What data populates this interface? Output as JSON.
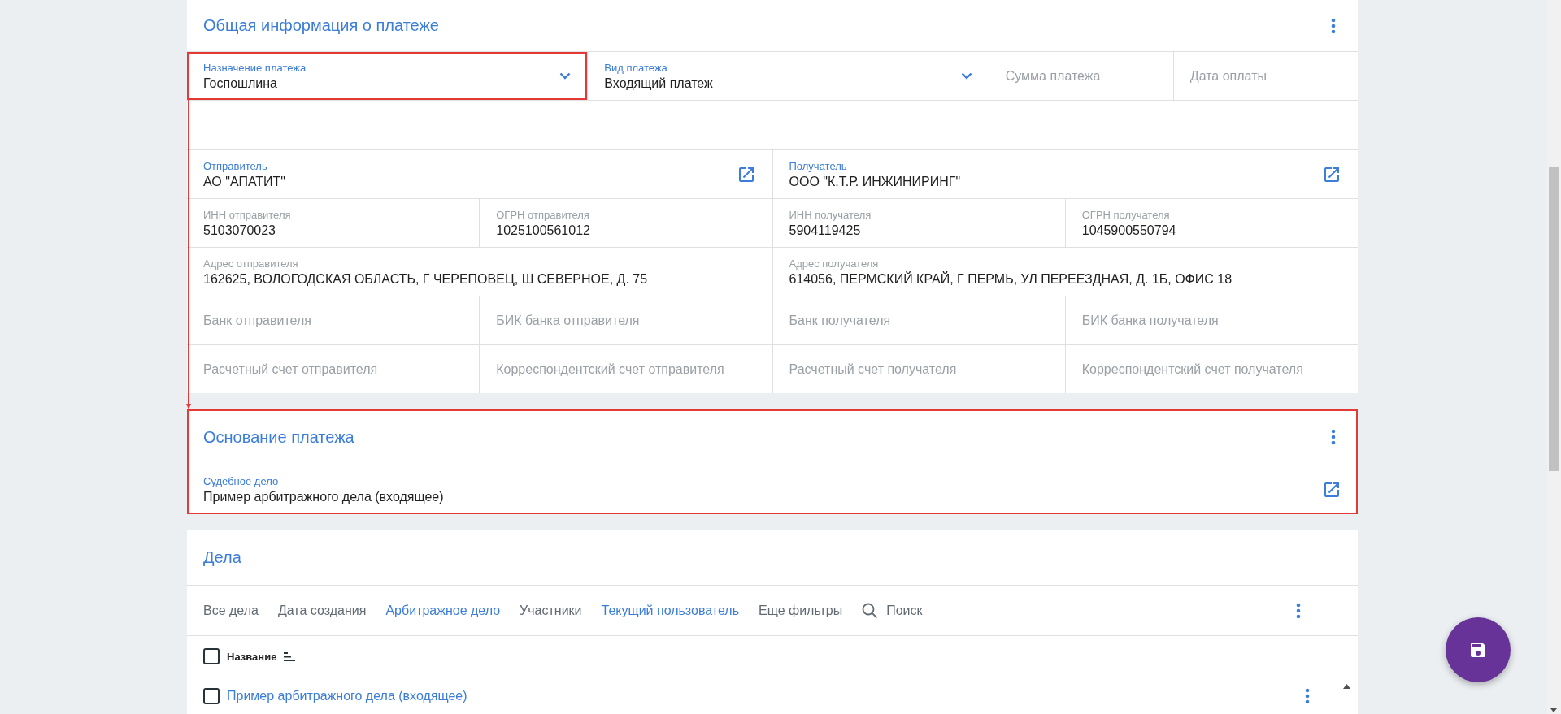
{
  "general": {
    "title": "Общая информация о платеже",
    "rows": [
      {
        "kind": "fields",
        "fields": [
          {
            "kind": "select",
            "label": "Назначение платежа",
            "value": "Госпошлина",
            "highlighted": true
          },
          {
            "kind": "select",
            "label": "Вид платежа",
            "value": "Входящий платеж",
            "highlighted": false
          },
          {
            "kind": "input",
            "placeholder": "Сумма платежа"
          },
          {
            "kind": "input",
            "placeholder": "Дата оплаты"
          }
        ]
      },
      {
        "kind": "spacer"
      },
      {
        "kind": "fields",
        "fields": [
          {
            "kind": "link",
            "label": "Отправитель",
            "value": "АО \"АПАТИТ\""
          },
          {
            "kind": "link",
            "label": "Получатель",
            "value": "ООО \"К.Т.Р. ИНЖИНИРИНГ\""
          }
        ]
      },
      {
        "kind": "fields",
        "fields": [
          {
            "kind": "text",
            "label": "ИНН отправителя",
            "value": "5103070023"
          },
          {
            "kind": "text",
            "label": "ОГРН отправителя",
            "value": "1025100561012"
          },
          {
            "kind": "text",
            "label": "ИНН получателя",
            "value": "5904119425"
          },
          {
            "kind": "text",
            "label": "ОГРН получателя",
            "value": "1045900550794"
          }
        ]
      },
      {
        "kind": "fields",
        "fields": [
          {
            "kind": "text",
            "label": "Адрес отправителя",
            "value": "162625, ВОЛОГОДСКАЯ ОБЛАСТЬ, Г ЧЕРЕПОВЕЦ, Ш СЕВЕРНОЕ, Д. 75"
          },
          {
            "kind": "text",
            "label": "Адрес получателя",
            "value": "614056, ПЕРМСКИЙ КРАЙ, Г ПЕРМЬ, УЛ ПЕРЕЕЗДНАЯ, Д. 1Б, ОФИС 18"
          }
        ]
      },
      {
        "kind": "fields",
        "fields": [
          {
            "kind": "input",
            "placeholder": "Банк отправителя"
          },
          {
            "kind": "input",
            "placeholder": "БИК банка отправителя"
          },
          {
            "kind": "input",
            "placeholder": "Банк получателя"
          },
          {
            "kind": "input",
            "placeholder": "БИК банка получателя"
          }
        ]
      },
      {
        "kind": "fields",
        "fields": [
          {
            "kind": "input",
            "placeholder": "Расчетный счет отправителя"
          },
          {
            "kind": "input",
            "placeholder": "Корреспондентский счет отправителя"
          },
          {
            "kind": "input",
            "placeholder": "Расчетный счет получателя"
          },
          {
            "kind": "input",
            "placeholder": "Корреспондентский счет получателя"
          }
        ]
      }
    ]
  },
  "annotation_arrow": true,
  "basis": {
    "title": "Основание платежа",
    "highlighted": true,
    "field": {
      "kind": "link",
      "label": "Судебное дело",
      "value": "Пример арбитражного дела (входящее)"
    }
  },
  "cases": {
    "title": "Дела",
    "filters": [
      {
        "label": "Все дела",
        "active": false
      },
      {
        "label": "Дата создания",
        "active": false
      },
      {
        "label": "Арбитражное дело",
        "active": true
      },
      {
        "label": "Участники",
        "active": false
      },
      {
        "label": "Текущий пользователь",
        "active": true
      },
      {
        "label": "Еще фильтры",
        "active": false
      }
    ],
    "search": {
      "placeholder": "Поиск"
    },
    "table": {
      "columns": [
        {
          "label": "Название",
          "checked": false
        }
      ],
      "rows": [
        {
          "name": "Пример арбитражного дела (входящее)",
          "checked": false
        }
      ]
    }
  }
}
